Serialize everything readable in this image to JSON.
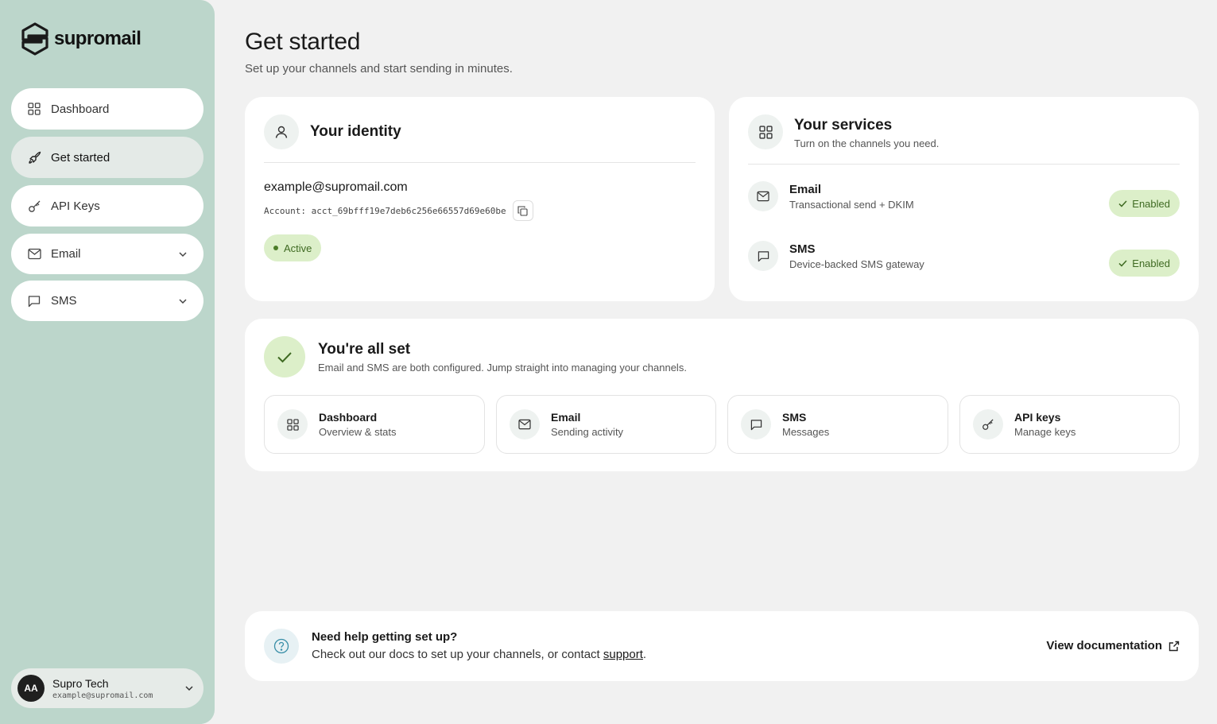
{
  "brand": {
    "name": "supromail"
  },
  "sidebar": {
    "items": [
      {
        "label": "Dashboard",
        "icon": "grid-icon"
      },
      {
        "label": "Get started",
        "icon": "rocket-icon"
      },
      {
        "label": "API Keys",
        "icon": "key-icon"
      },
      {
        "label": "Email",
        "icon": "mail-icon"
      },
      {
        "label": "SMS",
        "icon": "message-icon"
      }
    ],
    "active": "Get started"
  },
  "user": {
    "initials": "AA",
    "name": "Supro Tech",
    "email": "example@supromail.com"
  },
  "header": {
    "title": "Get started",
    "subtitle": "Set up your channels and start sending in minutes."
  },
  "identity": {
    "title": "Your identity",
    "email": "example@supromail.com",
    "account_label": "Account:",
    "account_id": "acct_69bfff19e7deb6c256e66557d69e60be",
    "status": "Active"
  },
  "services": {
    "title": "Your services",
    "subtitle": "Turn on the channels you need.",
    "items": [
      {
        "name": "Email",
        "desc": "Transactional send + DKIM",
        "status": "Enabled"
      },
      {
        "name": "SMS",
        "desc": "Device-backed SMS gateway",
        "status": "Enabled"
      }
    ]
  },
  "all_set": {
    "title": "You're all set",
    "subtitle": "Email and SMS are both configured. Jump straight into managing your channels.",
    "links": [
      {
        "title": "Dashboard",
        "sub": "Overview & stats"
      },
      {
        "title": "Email",
        "sub": "Sending activity"
      },
      {
        "title": "SMS",
        "sub": "Messages"
      },
      {
        "title": "API keys",
        "sub": "Manage keys"
      }
    ]
  },
  "help": {
    "title": "Need help getting set up?",
    "text_before": "Check out our docs to set up your channels, or contact ",
    "link": "support",
    "text_after": ".",
    "docs_label": "View documentation"
  },
  "colors": {
    "sidebar_bg": "#bcd6cb",
    "badge_bg": "#dcefc9",
    "badge_text": "#3f6a22",
    "page_bg": "#f1f1f1"
  }
}
